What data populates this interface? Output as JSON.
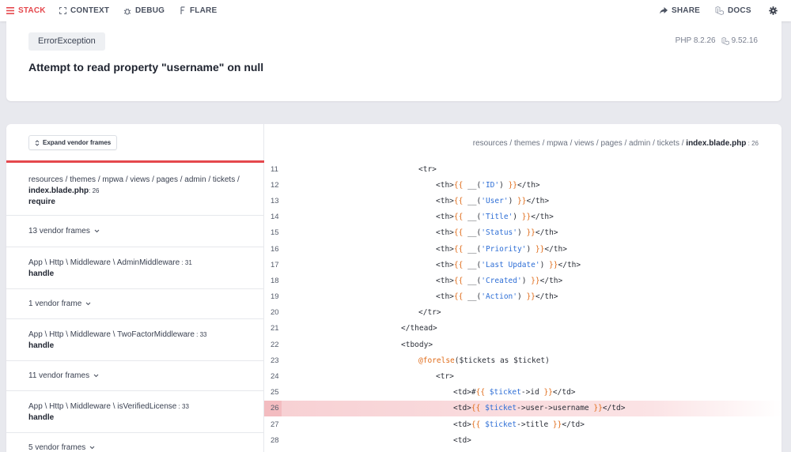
{
  "nav": {
    "stack": "STACK",
    "context": "CONTEXT",
    "debug": "DEBUG",
    "flare": "FLARE",
    "share": "SHARE",
    "docs": "DOCS"
  },
  "header": {
    "exception_class": "ErrorException",
    "php_version": "PHP 8.2.26",
    "laravel_version": "9.52.16",
    "message": "Attempt to read property \"username\" on null"
  },
  "frames": {
    "expand_label": "Expand vendor frames",
    "items": [
      {
        "type": "app",
        "path_line1": "resources / themes / mpwa / views / pages / admin / tickets /",
        "file": "index.blade.php",
        "line": ": 26",
        "method": "require"
      },
      {
        "type": "vendor",
        "label": "13 vendor frames"
      },
      {
        "type": "app",
        "path_line1": "",
        "file": "App \\ Http \\ Middleware \\ AdminMiddleware",
        "line": " : 31",
        "method": "handle"
      },
      {
        "type": "vendor",
        "label": "1 vendor frame"
      },
      {
        "type": "app",
        "path_line1": "",
        "file": "App \\ Http \\ Middleware \\ TwoFactorMiddleware",
        "line": " : 33",
        "method": "handle"
      },
      {
        "type": "vendor",
        "label": "11 vendor frames"
      },
      {
        "type": "app",
        "path_line1": "",
        "file": "App \\ Http \\ Middleware \\ isVerifiedLicense",
        "line": " : 33",
        "method": "handle"
      },
      {
        "type": "vendor",
        "label": "5 vendor frames"
      }
    ]
  },
  "code": {
    "file_path": "resources / themes / mpwa / views / pages / admin / tickets / ",
    "file_name": "index.blade.php",
    "file_line": " : 26",
    "highlight_line": "26",
    "lines": [
      {
        "num": "11",
        "text": "<tr>"
      },
      {
        "num": "12",
        "text": "<th>{{ __('ID') }}</th>"
      },
      {
        "num": "13",
        "text": "<th>{{ __('User') }}</th>"
      },
      {
        "num": "14",
        "text": "<th>{{ __('Title') }}</th>"
      },
      {
        "num": "15",
        "text": "<th>{{ __('Status') }}</th>"
      },
      {
        "num": "16",
        "text": "<th>{{ __('Priority') }}</th>"
      },
      {
        "num": "17",
        "text": "<th>{{ __('Last Update') }}</th>"
      },
      {
        "num": "18",
        "text": "<th>{{ __('Created') }}</th>"
      },
      {
        "num": "19",
        "text": "<th>{{ __('Action') }}</th>"
      },
      {
        "num": "20",
        "text": "</tr>"
      },
      {
        "num": "21",
        "text": "</thead>"
      },
      {
        "num": "22",
        "text": "<tbody>"
      },
      {
        "num": "23",
        "text": "@forelse($tickets as $ticket)"
      },
      {
        "num": "24",
        "text": "<tr>"
      },
      {
        "num": "25",
        "text": "<td>#{{ $ticket->id }}</td>"
      },
      {
        "num": "26",
        "text": "<td>{{ $ticket->user->username }}</td>"
      },
      {
        "num": "27",
        "text": "<td>{{ $ticket->title }}</td>"
      },
      {
        "num": "28",
        "text": "<td>"
      }
    ]
  },
  "colors": {
    "accent": "#e5484d",
    "highlight": "#f7d0d3",
    "blade_brace": "#e06c1a",
    "string": "#2f6fd6"
  }
}
